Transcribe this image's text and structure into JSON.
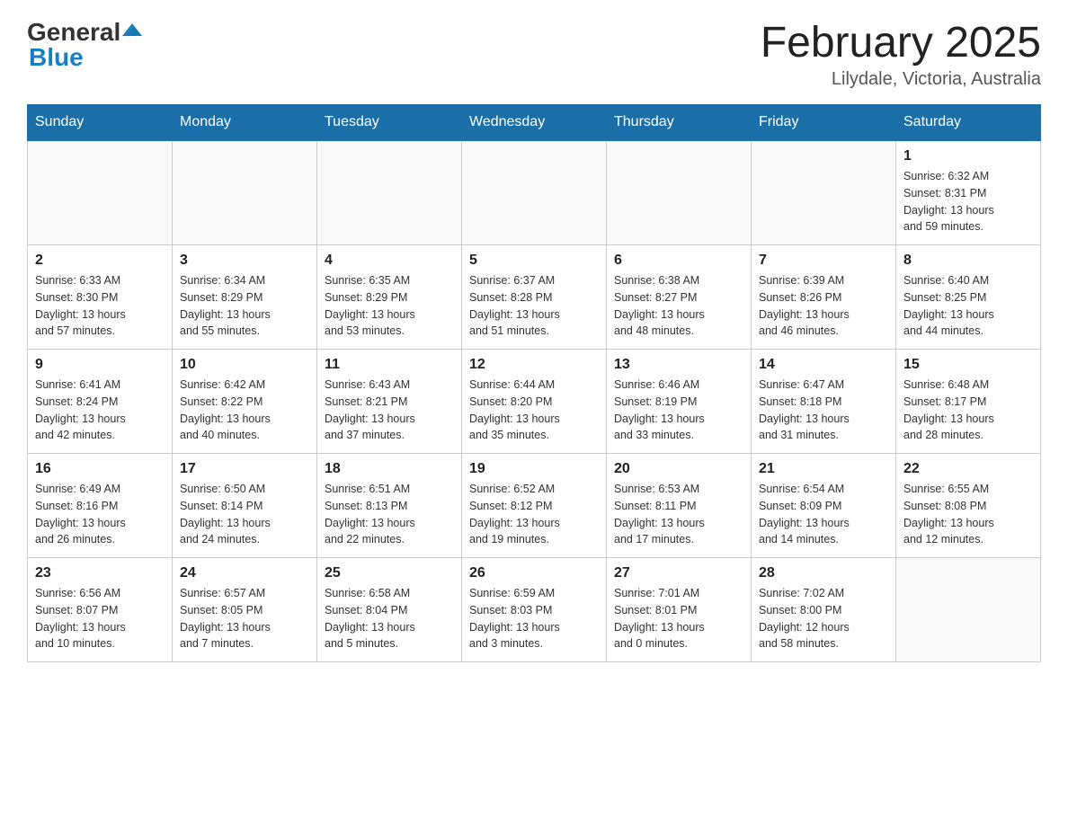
{
  "header": {
    "logo_general": "General",
    "logo_blue": "Blue",
    "month_title": "February 2025",
    "location": "Lilydale, Victoria, Australia"
  },
  "days_of_week": [
    "Sunday",
    "Monday",
    "Tuesday",
    "Wednesday",
    "Thursday",
    "Friday",
    "Saturday"
  ],
  "weeks": [
    [
      {
        "day": "",
        "info": ""
      },
      {
        "day": "",
        "info": ""
      },
      {
        "day": "",
        "info": ""
      },
      {
        "day": "",
        "info": ""
      },
      {
        "day": "",
        "info": ""
      },
      {
        "day": "",
        "info": ""
      },
      {
        "day": "1",
        "info": "Sunrise: 6:32 AM\nSunset: 8:31 PM\nDaylight: 13 hours\nand 59 minutes."
      }
    ],
    [
      {
        "day": "2",
        "info": "Sunrise: 6:33 AM\nSunset: 8:30 PM\nDaylight: 13 hours\nand 57 minutes."
      },
      {
        "day": "3",
        "info": "Sunrise: 6:34 AM\nSunset: 8:29 PM\nDaylight: 13 hours\nand 55 minutes."
      },
      {
        "day": "4",
        "info": "Sunrise: 6:35 AM\nSunset: 8:29 PM\nDaylight: 13 hours\nand 53 minutes."
      },
      {
        "day": "5",
        "info": "Sunrise: 6:37 AM\nSunset: 8:28 PM\nDaylight: 13 hours\nand 51 minutes."
      },
      {
        "day": "6",
        "info": "Sunrise: 6:38 AM\nSunset: 8:27 PM\nDaylight: 13 hours\nand 48 minutes."
      },
      {
        "day": "7",
        "info": "Sunrise: 6:39 AM\nSunset: 8:26 PM\nDaylight: 13 hours\nand 46 minutes."
      },
      {
        "day": "8",
        "info": "Sunrise: 6:40 AM\nSunset: 8:25 PM\nDaylight: 13 hours\nand 44 minutes."
      }
    ],
    [
      {
        "day": "9",
        "info": "Sunrise: 6:41 AM\nSunset: 8:24 PM\nDaylight: 13 hours\nand 42 minutes."
      },
      {
        "day": "10",
        "info": "Sunrise: 6:42 AM\nSunset: 8:22 PM\nDaylight: 13 hours\nand 40 minutes."
      },
      {
        "day": "11",
        "info": "Sunrise: 6:43 AM\nSunset: 8:21 PM\nDaylight: 13 hours\nand 37 minutes."
      },
      {
        "day": "12",
        "info": "Sunrise: 6:44 AM\nSunset: 8:20 PM\nDaylight: 13 hours\nand 35 minutes."
      },
      {
        "day": "13",
        "info": "Sunrise: 6:46 AM\nSunset: 8:19 PM\nDaylight: 13 hours\nand 33 minutes."
      },
      {
        "day": "14",
        "info": "Sunrise: 6:47 AM\nSunset: 8:18 PM\nDaylight: 13 hours\nand 31 minutes."
      },
      {
        "day": "15",
        "info": "Sunrise: 6:48 AM\nSunset: 8:17 PM\nDaylight: 13 hours\nand 28 minutes."
      }
    ],
    [
      {
        "day": "16",
        "info": "Sunrise: 6:49 AM\nSunset: 8:16 PM\nDaylight: 13 hours\nand 26 minutes."
      },
      {
        "day": "17",
        "info": "Sunrise: 6:50 AM\nSunset: 8:14 PM\nDaylight: 13 hours\nand 24 minutes."
      },
      {
        "day": "18",
        "info": "Sunrise: 6:51 AM\nSunset: 8:13 PM\nDaylight: 13 hours\nand 22 minutes."
      },
      {
        "day": "19",
        "info": "Sunrise: 6:52 AM\nSunset: 8:12 PM\nDaylight: 13 hours\nand 19 minutes."
      },
      {
        "day": "20",
        "info": "Sunrise: 6:53 AM\nSunset: 8:11 PM\nDaylight: 13 hours\nand 17 minutes."
      },
      {
        "day": "21",
        "info": "Sunrise: 6:54 AM\nSunset: 8:09 PM\nDaylight: 13 hours\nand 14 minutes."
      },
      {
        "day": "22",
        "info": "Sunrise: 6:55 AM\nSunset: 8:08 PM\nDaylight: 13 hours\nand 12 minutes."
      }
    ],
    [
      {
        "day": "23",
        "info": "Sunrise: 6:56 AM\nSunset: 8:07 PM\nDaylight: 13 hours\nand 10 minutes."
      },
      {
        "day": "24",
        "info": "Sunrise: 6:57 AM\nSunset: 8:05 PM\nDaylight: 13 hours\nand 7 minutes."
      },
      {
        "day": "25",
        "info": "Sunrise: 6:58 AM\nSunset: 8:04 PM\nDaylight: 13 hours\nand 5 minutes."
      },
      {
        "day": "26",
        "info": "Sunrise: 6:59 AM\nSunset: 8:03 PM\nDaylight: 13 hours\nand 3 minutes."
      },
      {
        "day": "27",
        "info": "Sunrise: 7:01 AM\nSunset: 8:01 PM\nDaylight: 13 hours\nand 0 minutes."
      },
      {
        "day": "28",
        "info": "Sunrise: 7:02 AM\nSunset: 8:00 PM\nDaylight: 12 hours\nand 58 minutes."
      },
      {
        "day": "",
        "info": ""
      }
    ]
  ]
}
